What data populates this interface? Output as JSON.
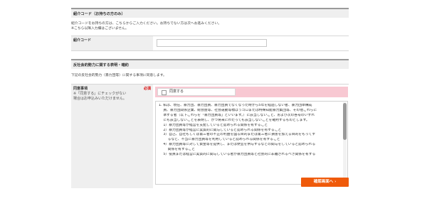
{
  "referral": {
    "section_title": "紹介コード（お持ちの方のみ）",
    "note_line1": "紹介コードをお持ちの方は、こちらからご入力ください。お持ちでない方は次へお進みください。",
    "note_line2": "※こちら以降入力欄はございません。",
    "field_label": "紹介コード",
    "field_value": ""
  },
  "antisocial": {
    "section_title": "反社会的勢力に関する表明・確約",
    "intro": "下記の反社会的勢力（暴力団等）に関する事項に同意します。",
    "field_label": "同意事項",
    "field_sub_line1": "※「同意する」にチェックがない",
    "field_sub_line2": "場合はお申込みいただけません。",
    "required_label": "必須",
    "checkbox_label": "同意する",
    "checkbox_checked": false,
    "terms_lines": [
      "1. 私は、現在、暴力団、暴力団員、暴力団員でなくなった時から5年を経過しない者、暴力団準構成",
      "　 員、暴力団関係企業、総会屋等、社会運動等標ぼうゴロまたは特殊知能暴力集団等、その他これらに",
      "　 準ずる者（以下これらを「暴力団員等」といいます。）に該当しないこと、および次の各号のいずれ",
      "　 にも該当しないことを表明し、かつ将来にわたっても該当しないことを確約するものとします。",
      "　 1）暴力団員等が経営を支配していると認められる関係を有すること",
      "　 2）暴力団員等が経営に実質的に関与していると認められる関係を有すること",
      "　 3）自己、自社もしくは第三者の不正の利益を図る目的または第三者に損害を加える目的をもってす",
      "　 　 るなど、不当に暴力団員等を利用していると認められる関係を有すること",
      "　 4）暴力団員等に対して資金等を提供し、または便宜を供与するなどの関与をしていると認められる",
      "　 　 関係を有すること",
      "　 5）役員または経営に実質的に関与している者が暴力団員等と社会的に非難されるべき関係を有する"
    ]
  },
  "actions": {
    "confirm_label": "確認画面へ",
    "confirm_arrow": "›"
  }
}
